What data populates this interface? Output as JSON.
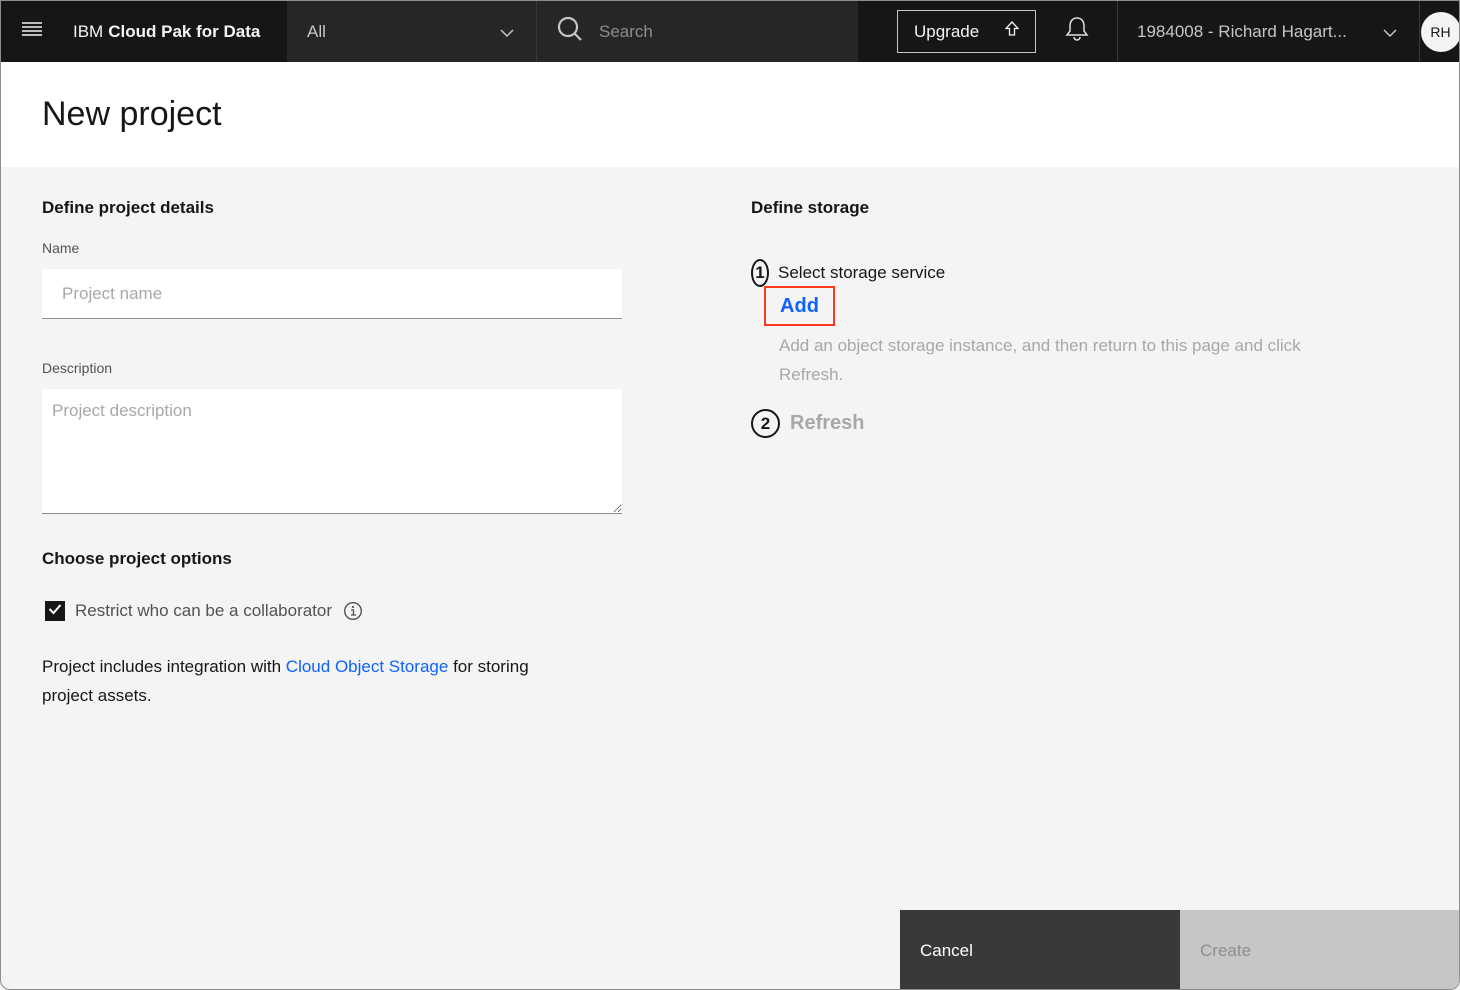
{
  "topbar": {
    "brand_prefix": "IBM",
    "brand_name": "Cloud Pak for Data",
    "scope_selected": "All",
    "search_placeholder": "Search",
    "upgrade_label": "Upgrade",
    "account_label": "1984008 - Richard Hagart...",
    "avatar_initials": "RH",
    "icons": {
      "menu": "hamburger-menu-icon",
      "scope": "chevron-down-icon",
      "search": "search-icon",
      "upgrade": "upgrade-arrow-icon",
      "notifications": "bell-icon",
      "account": "chevron-down-icon"
    }
  },
  "page": {
    "title": "New project"
  },
  "details": {
    "section_title": "Define project details",
    "name_label": "Name",
    "name_value": "",
    "name_placeholder": "Project name",
    "description_label": "Description",
    "description_value": "",
    "description_placeholder": "Project description"
  },
  "options": {
    "section_title": "Choose project options",
    "restrict_label": "Restrict who can be a collaborator",
    "restrict_checked": true,
    "integration_prefix": "Project includes integration with ",
    "integration_link": "Cloud Object Storage",
    "integration_suffix": " for storing project assets."
  },
  "storage": {
    "section_title": "Define storage",
    "step1_number": "1",
    "step1_label": "Select storage service",
    "add_label": "Add",
    "hint": "Add an object storage instance, and then return to this page and click Refresh.",
    "step2_number": "2",
    "refresh_label": "Refresh"
  },
  "footer": {
    "cancel_label": "Cancel",
    "create_label": "Create"
  },
  "colors": {
    "link": "#0f62fe",
    "highlight": "#fa3a1e",
    "topbar": "#161616"
  }
}
